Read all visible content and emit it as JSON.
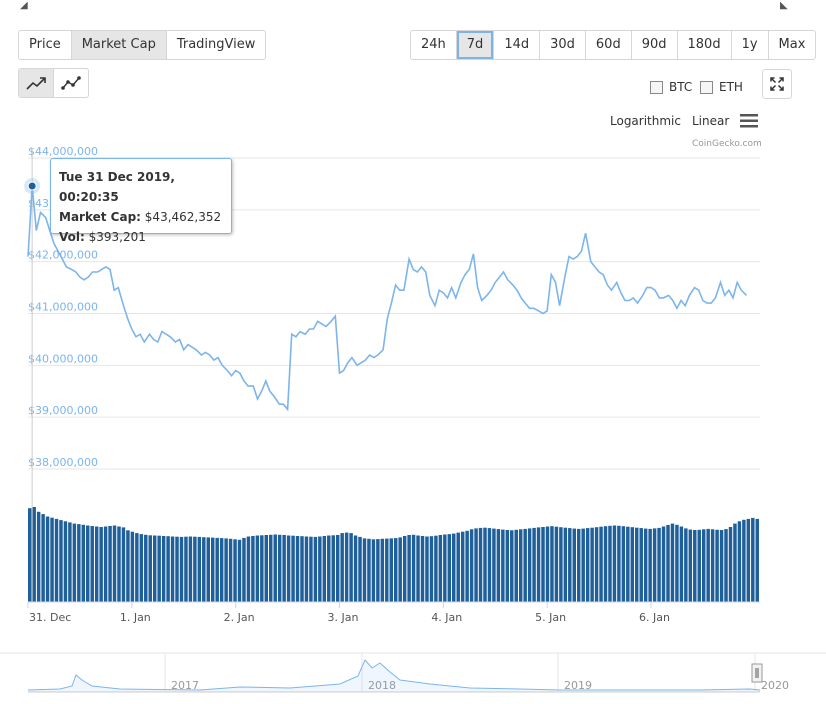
{
  "tabs": [
    "Price",
    "Market Cap",
    "TradingView"
  ],
  "active_tab": "Market Cap",
  "ranges": [
    "24h",
    "7d",
    "14d",
    "30d",
    "60d",
    "90d",
    "180d",
    "1y",
    "Max"
  ],
  "selected_range": "7d",
  "line_style_icons": [
    "line-chart-icon",
    "point-line-chart-icon"
  ],
  "compare": {
    "btc_label": "BTC",
    "eth_label": "ETH",
    "btc_checked": false,
    "eth_checked": false
  },
  "scale": {
    "log_label": "Logarithmic",
    "linear_label": "Linear"
  },
  "credits": "CoinGecko.com",
  "colors": {
    "line": "#7cb5ec",
    "bar": "#1f5f9a",
    "grid": "#e6e6e6",
    "axis_label": "#7cb5ec",
    "selected_border": "#7fb2e5"
  },
  "tooltip": {
    "date": "Tue 31 Dec 2019, 00:20:35",
    "cap_label": "Market Cap:",
    "cap_value": "$43,462,352",
    "vol_label": "Vol:",
    "vol_value": "$393,201"
  },
  "chart_data": {
    "type": "line",
    "y_tick_labels": [
      "$44,000,000",
      "$43,000,000",
      "$42,000,000",
      "$41,000,000",
      "$40,000,000",
      "$39,000,000",
      "$38,000,000"
    ],
    "ylim": [
      38000000,
      44000000
    ],
    "x_tick_labels": [
      "31. Dec",
      "1. Jan",
      "2. Jan",
      "3. Jan",
      "4. Jan",
      "5. Jan",
      "6. Jan"
    ],
    "xlim": [
      0,
      7.05
    ],
    "grid": true,
    "series": [
      {
        "values": [
          [
            0.0,
            42100000
          ],
          [
            0.04,
            43460000
          ],
          [
            0.08,
            42600000
          ],
          [
            0.12,
            42950000
          ],
          [
            0.17,
            42850000
          ],
          [
            0.21,
            42600000
          ],
          [
            0.25,
            42350000
          ],
          [
            0.29,
            42200000
          ],
          [
            0.33,
            42050000
          ],
          [
            0.37,
            41900000
          ],
          [
            0.42,
            41850000
          ],
          [
            0.46,
            41800000
          ],
          [
            0.5,
            41700000
          ],
          [
            0.54,
            41650000
          ],
          [
            0.58,
            41700000
          ],
          [
            0.62,
            41800000
          ],
          [
            0.67,
            41800000
          ],
          [
            0.71,
            41850000
          ],
          [
            0.75,
            41900000
          ],
          [
            0.79,
            41850000
          ],
          [
            0.83,
            41450000
          ],
          [
            0.87,
            41500000
          ],
          [
            0.92,
            41150000
          ],
          [
            0.96,
            40900000
          ],
          [
            1.0,
            40700000
          ],
          [
            1.04,
            40550000
          ],
          [
            1.08,
            40600000
          ],
          [
            1.12,
            40450000
          ],
          [
            1.17,
            40600000
          ],
          [
            1.21,
            40500000
          ],
          [
            1.25,
            40450000
          ],
          [
            1.29,
            40650000
          ],
          [
            1.33,
            40600000
          ],
          [
            1.37,
            40550000
          ],
          [
            1.42,
            40450000
          ],
          [
            1.46,
            40500000
          ],
          [
            1.5,
            40300000
          ],
          [
            1.54,
            40400000
          ],
          [
            1.58,
            40350000
          ],
          [
            1.62,
            40300000
          ],
          [
            1.67,
            40200000
          ],
          [
            1.71,
            40250000
          ],
          [
            1.75,
            40200000
          ],
          [
            1.79,
            40100000
          ],
          [
            1.83,
            40150000
          ],
          [
            1.87,
            40000000
          ],
          [
            1.92,
            39900000
          ],
          [
            1.96,
            39800000
          ],
          [
            2.0,
            39900000
          ],
          [
            2.04,
            39850000
          ],
          [
            2.08,
            39700000
          ],
          [
            2.12,
            39600000
          ],
          [
            2.17,
            39600000
          ],
          [
            2.21,
            39350000
          ],
          [
            2.25,
            39500000
          ],
          [
            2.29,
            39700000
          ],
          [
            2.33,
            39500000
          ],
          [
            2.37,
            39400000
          ],
          [
            2.42,
            39250000
          ],
          [
            2.46,
            39250000
          ],
          [
            2.5,
            39150000
          ],
          [
            2.54,
            40600000
          ],
          [
            2.58,
            40550000
          ],
          [
            2.62,
            40650000
          ],
          [
            2.67,
            40600000
          ],
          [
            2.71,
            40700000
          ],
          [
            2.75,
            40700000
          ],
          [
            2.79,
            40850000
          ],
          [
            2.83,
            40800000
          ],
          [
            2.87,
            40750000
          ],
          [
            2.92,
            40850000
          ],
          [
            2.96,
            40950000
          ],
          [
            3.0,
            39850000
          ],
          [
            3.04,
            39900000
          ],
          [
            3.08,
            40050000
          ],
          [
            3.12,
            40150000
          ],
          [
            3.17,
            40000000
          ],
          [
            3.21,
            40050000
          ],
          [
            3.25,
            40100000
          ],
          [
            3.29,
            40200000
          ],
          [
            3.33,
            40150000
          ],
          [
            3.37,
            40200000
          ],
          [
            3.42,
            40300000
          ],
          [
            3.46,
            40900000
          ],
          [
            3.5,
            41200000
          ],
          [
            3.54,
            41550000
          ],
          [
            3.58,
            41450000
          ],
          [
            3.62,
            41450000
          ],
          [
            3.67,
            42050000
          ],
          [
            3.71,
            41850000
          ],
          [
            3.75,
            41800000
          ],
          [
            3.79,
            41900000
          ],
          [
            3.83,
            41800000
          ],
          [
            3.87,
            41350000
          ],
          [
            3.92,
            41150000
          ],
          [
            3.96,
            41450000
          ],
          [
            4.0,
            41400000
          ],
          [
            4.04,
            41300000
          ],
          [
            4.08,
            41500000
          ],
          [
            4.12,
            41300000
          ],
          [
            4.17,
            41600000
          ],
          [
            4.21,
            41750000
          ],
          [
            4.25,
            41850000
          ],
          [
            4.29,
            42150000
          ],
          [
            4.33,
            41500000
          ],
          [
            4.37,
            41250000
          ],
          [
            4.42,
            41350000
          ],
          [
            4.46,
            41450000
          ],
          [
            4.5,
            41600000
          ],
          [
            4.54,
            41700000
          ],
          [
            4.58,
            41800000
          ],
          [
            4.62,
            41650000
          ],
          [
            4.67,
            41550000
          ],
          [
            4.71,
            41450000
          ],
          [
            4.75,
            41300000
          ],
          [
            4.79,
            41200000
          ],
          [
            4.83,
            41100000
          ],
          [
            4.87,
            41100000
          ],
          [
            4.92,
            41050000
          ],
          [
            4.96,
            41000000
          ],
          [
            5.0,
            41050000
          ],
          [
            5.04,
            41750000
          ],
          [
            5.08,
            41600000
          ],
          [
            5.12,
            41150000
          ],
          [
            5.17,
            41700000
          ],
          [
            5.21,
            42100000
          ],
          [
            5.25,
            42050000
          ],
          [
            5.29,
            42100000
          ],
          [
            5.33,
            42200000
          ],
          [
            5.37,
            42550000
          ],
          [
            5.42,
            42000000
          ],
          [
            5.46,
            41900000
          ],
          [
            5.5,
            41800000
          ],
          [
            5.54,
            41750000
          ],
          [
            5.58,
            41550000
          ],
          [
            5.62,
            41450000
          ],
          [
            5.67,
            41600000
          ],
          [
            5.71,
            41400000
          ],
          [
            5.75,
            41250000
          ],
          [
            5.79,
            41250000
          ],
          [
            5.83,
            41300000
          ],
          [
            5.87,
            41200000
          ],
          [
            5.92,
            41350000
          ],
          [
            5.96,
            41500000
          ],
          [
            6.0,
            41500000
          ],
          [
            6.04,
            41450000
          ],
          [
            6.08,
            41300000
          ],
          [
            6.12,
            41300000
          ],
          [
            6.17,
            41350000
          ],
          [
            6.21,
            41250000
          ],
          [
            6.25,
            41100000
          ],
          [
            6.29,
            41250000
          ],
          [
            6.33,
            41150000
          ],
          [
            6.37,
            41350000
          ],
          [
            6.42,
            41500000
          ],
          [
            6.46,
            41450000
          ],
          [
            6.5,
            41250000
          ],
          [
            6.54,
            41200000
          ],
          [
            6.58,
            41200000
          ],
          [
            6.62,
            41300000
          ],
          [
            6.67,
            41600000
          ],
          [
            6.71,
            41350000
          ],
          [
            6.75,
            41450000
          ],
          [
            6.79,
            41300000
          ],
          [
            6.83,
            41600000
          ],
          [
            6.87,
            41450000
          ],
          [
            6.92,
            41350000
          ]
        ]
      }
    ],
    "volume": {
      "type": "bar",
      "values": [
        395000,
        400000,
        380000,
        370000,
        360000,
        355000,
        350000,
        345000,
        340000,
        335000,
        330000,
        328000,
        325000,
        322000,
        320000,
        318000,
        316000,
        318000,
        320000,
        322000,
        318000,
        314000,
        302000,
        296000,
        290000,
        286000,
        283000,
        281000,
        280000,
        279000,
        278000,
        277000,
        276000,
        275000,
        274000,
        275000,
        276000,
        275000,
        274000,
        273000,
        272000,
        271000,
        270000,
        269000,
        268000,
        266000,
        264000,
        262000,
        270000,
        276000,
        278000,
        280000,
        281000,
        282000,
        283000,
        284000,
        283000,
        282000,
        280000,
        279000,
        278000,
        277000,
        276000,
        275000,
        274000,
        276000,
        278000,
        280000,
        281000,
        282000,
        290000,
        292000,
        290000,
        280000,
        274000,
        268000,
        266000,
        264000,
        265000,
        266000,
        267000,
        268000,
        269000,
        272000,
        278000,
        282000,
        283000,
        280000,
        278000,
        276000,
        277000,
        279000,
        282000,
        284000,
        286000,
        288000,
        292000,
        296000,
        300000,
        306000,
        310000,
        312000,
        313000,
        311000,
        309000,
        307000,
        305000,
        303000,
        302000,
        304000,
        306000,
        308000,
        310000,
        312000,
        314000,
        316000,
        318000,
        319000,
        317000,
        315000,
        313000,
        311000,
        309000,
        308000,
        309000,
        311000,
        313000,
        315000,
        317000,
        319000,
        321000,
        322000,
        321000,
        319000,
        317000,
        315000,
        313000,
        311000,
        309000,
        308000,
        310000,
        312000,
        318000,
        324000,
        330000,
        325000,
        318000,
        310000,
        305000,
        303000,
        304000,
        306000,
        308000,
        306000,
        304000,
        303000,
        307000,
        316000,
        330000,
        340000,
        346000,
        350000,
        354000,
        350000
      ]
    },
    "navigator": {
      "x_tick_labels": [
        "2017",
        "2018",
        "2019",
        "2020"
      ]
    }
  }
}
